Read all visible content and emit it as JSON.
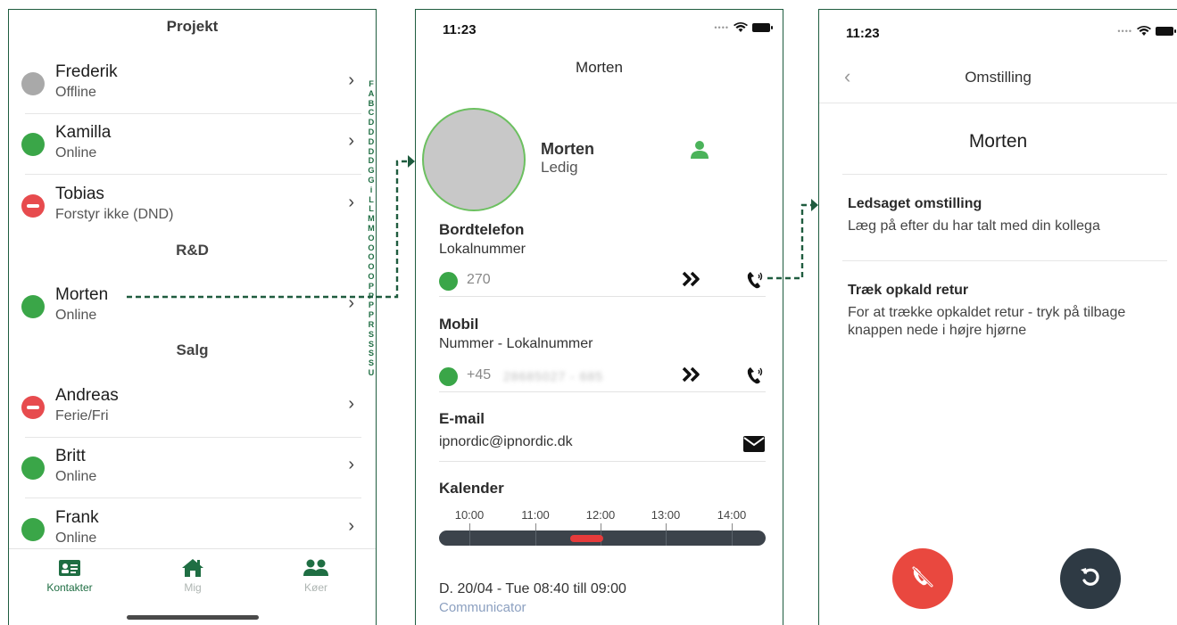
{
  "contacts_screen": {
    "title": "Projekt",
    "contacts": [
      {
        "name": "Frederik",
        "status": "Offline",
        "state": "offline"
      },
      {
        "name": "Kamilla",
        "status": "Online",
        "state": "online"
      },
      {
        "name": "Tobias",
        "status": "Forstyr ikke (DND)",
        "state": "dnd"
      },
      {
        "name": "Morten",
        "status": "Online",
        "state": "online"
      },
      {
        "name": "Andreas",
        "status": "Ferie/Fri",
        "state": "dnd"
      },
      {
        "name": "Britt",
        "status": "Online",
        "state": "online"
      },
      {
        "name": "Frank",
        "status": "Online",
        "state": "online"
      }
    ],
    "sections": [
      "R&D",
      "Salg"
    ],
    "alphabet_index": [
      "F",
      "A",
      "B",
      "C",
      "D",
      "D",
      "D",
      "D",
      "D",
      "G",
      "G",
      "i",
      "L",
      "L",
      "M",
      "M",
      "O",
      "O",
      "O",
      "O",
      "O",
      "P",
      "P",
      "P",
      "P",
      "R",
      "S",
      "S",
      "S",
      "S",
      "U"
    ],
    "tabs": [
      {
        "label": "Kontakter",
        "icon": "contact-card-icon",
        "active": true
      },
      {
        "label": "Mig",
        "icon": "home-icon",
        "active": false
      },
      {
        "label": "Køer",
        "icon": "group-icon",
        "active": false
      }
    ],
    "colors": {
      "online": "#3aa648",
      "offline": "#a9a9a9",
      "dnd": "#e74b4e",
      "accent": "#1f6e43"
    }
  },
  "detail_screen": {
    "status_time": "11:23",
    "title": "Morten",
    "name": "Morten",
    "status": "Ledig",
    "desk_phone": {
      "heading": "Bordtelefon",
      "sub": "Lokalnummer",
      "value": "270"
    },
    "mobile": {
      "heading": "Mobil",
      "sub": "Nummer - Lokalnummer",
      "prefix": "+45",
      "masked": "28685027 - 685"
    },
    "email": {
      "heading": "E-mail",
      "value": "ipnordic@ipnordic.dk"
    },
    "calendar": {
      "heading": "Kalender",
      "times": [
        "10:00",
        "11:00",
        "12:00",
        "13:00",
        "14:00"
      ],
      "event_line": "D. 20/04 - Tue   08:40 till 09:00",
      "event_source": "Communicator"
    }
  },
  "transfer_screen": {
    "status_time": "11:23",
    "title": "Omstilling",
    "name": "Morten",
    "options": [
      {
        "heading": "Ledsaget omstilling",
        "description": "Læg på efter du har talt med din kollega"
      },
      {
        "heading": "Træk opkald retur",
        "description": "For at trække opkaldet retur - tryk på tilbage knappen nede i højre hjørne"
      }
    ],
    "colors": {
      "hangup": "#e9483f",
      "return": "#2e3a44"
    }
  }
}
